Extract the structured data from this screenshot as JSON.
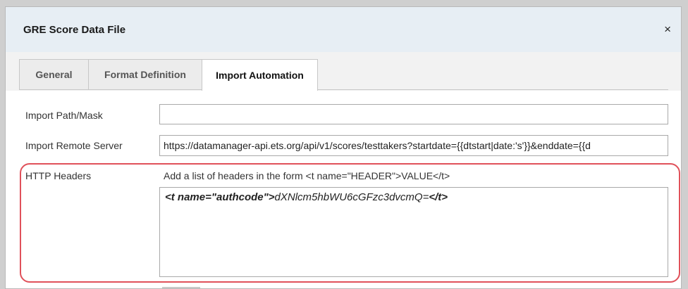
{
  "dialog": {
    "title": "GRE Score Data File",
    "close_glyph": "×"
  },
  "tabs": [
    {
      "label": "General",
      "active": false
    },
    {
      "label": "Format Definition",
      "active": false
    },
    {
      "label": "Import Automation",
      "active": true
    }
  ],
  "form": {
    "import_path": {
      "label": "Import Path/Mask",
      "value": ""
    },
    "remote_server": {
      "label": "Import Remote Server",
      "value": "https://datamanager-api.ets.org/api/v1/scores/testtakers?startdate={{dtstart|date:'s'}}&enddate={{d"
    },
    "http_headers": {
      "label": "HTTP Headers",
      "hint": "Add a list of headers in the form <t name=\"HEADER\">VALUE</t>",
      "open_tag": "<t name=\"authcode\">",
      "value_text": "dXNlcm5hbWU6cGFzc3dvcmQ=",
      "close_tag": "</t>"
    }
  },
  "colors": {
    "titlebar_bg": "#e7eef4",
    "highlight_border": "#e0515a"
  },
  "icons": {
    "close": "close-icon"
  }
}
